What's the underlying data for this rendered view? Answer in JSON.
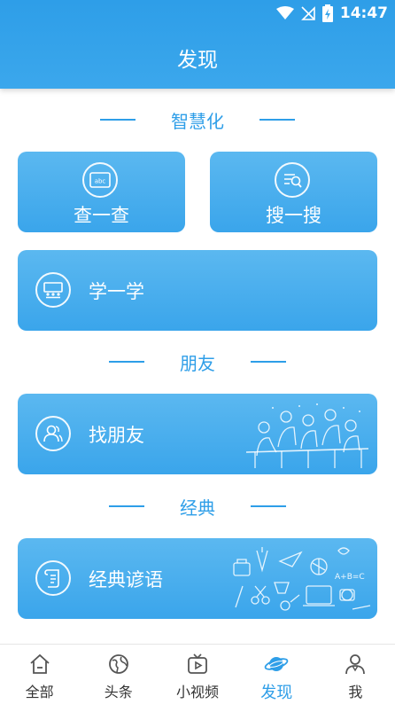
{
  "status_bar": {
    "time": "14:47"
  },
  "header": {
    "title": "发现"
  },
  "sections": {
    "smart": {
      "title": "智慧化"
    },
    "friends": {
      "title": "朋友"
    },
    "classics": {
      "title": "经典"
    }
  },
  "cards": {
    "check": {
      "label": "查一查",
      "icon": "abc-board-icon"
    },
    "search": {
      "label": "搜一搜",
      "icon": "search-doc-icon"
    },
    "learn": {
      "label": "学一学",
      "icon": "classroom-icon"
    },
    "find_friends": {
      "label": "找朋友",
      "icon": "people-icon"
    },
    "proverbs": {
      "label": "经典谚语",
      "icon": "scroll-icon"
    }
  },
  "colors": {
    "accent": "#2e9ee8",
    "card": "#4aaeee"
  },
  "tabbar": {
    "active": "发现",
    "tabs": [
      {
        "label": "全部",
        "icon": "home-icon"
      },
      {
        "label": "头条",
        "icon": "globe-icon"
      },
      {
        "label": "小视频",
        "icon": "video-icon"
      },
      {
        "label": "发现",
        "icon": "planet-icon"
      },
      {
        "label": "我",
        "icon": "user-icon"
      }
    ]
  }
}
